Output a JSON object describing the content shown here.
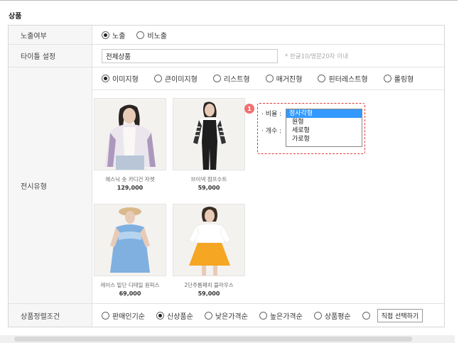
{
  "section_title": "상품",
  "rows": {
    "exposure": {
      "label": "노출여부",
      "options": [
        "노출",
        "비노출"
      ],
      "selected": "노출"
    },
    "title": {
      "label": "타이틀 설정",
      "value": "전체상품",
      "hint": "* 한글10/영문20자 이내"
    },
    "display": {
      "label": "전시유형",
      "options": [
        "이미지형",
        "큰이미지형",
        "리스트형",
        "매거진형",
        "핀터레스트형",
        "롤링형"
      ],
      "selected": "이미지형",
      "products": [
        {
          "name": "에스닉 숏 카디건 자켓",
          "price": "129,000"
        },
        {
          "name": "브이넥 점프수트",
          "price": "59,000"
        },
        {
          "name": "레이스 밑단 디테일 원피스",
          "price": "69,000"
        },
        {
          "name": "2단주름패치 블라우스",
          "price": "59,000"
        }
      ],
      "badge": "1",
      "ratio_label": "· 비율 :",
      "count_label": "· 개수 :",
      "ratio_options": [
        "정사각형",
        "원형",
        "세로형",
        "가로형"
      ],
      "ratio_selected": "정사각형"
    },
    "sort": {
      "label": "상품정렬조건",
      "options": [
        "판매인기순",
        "신상품순",
        "낮은가격순",
        "높은가격순",
        "상품평순"
      ],
      "selected": "신상품순",
      "custom_button": "직접 선택하기"
    }
  },
  "colors": {
    "highlight": "#e03a3a",
    "badge": "#f07070",
    "selection": "#3399ff"
  }
}
